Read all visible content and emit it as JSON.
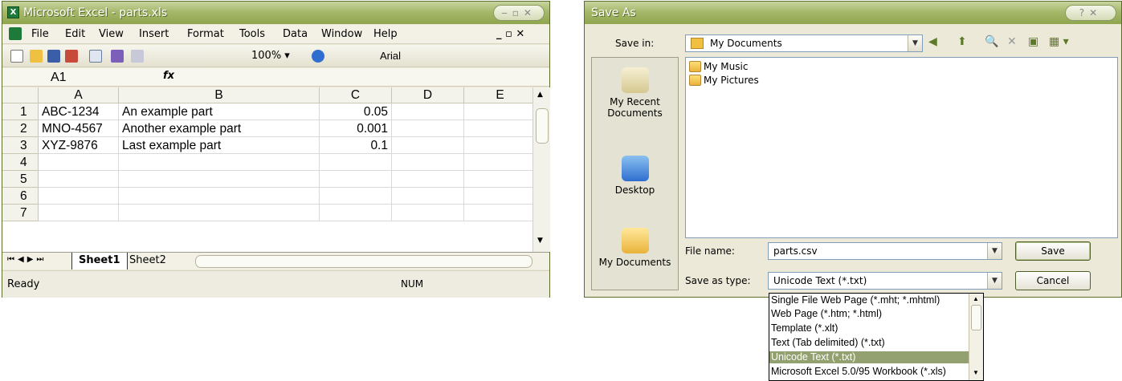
{
  "excel": {
    "title": "Microsoft Excel - parts.xls",
    "menu": [
      "File",
      "Edit",
      "View",
      "Insert",
      "Format",
      "Tools",
      "Data",
      "Window",
      "Help"
    ],
    "zoom": "100%",
    "font": "Arial",
    "name_box": "A1",
    "fx_label": "fx",
    "columns": [
      "A",
      "B",
      "C",
      "D",
      "E"
    ],
    "rows": [
      {
        "num": "1",
        "a": "ABC-1234",
        "b": "An example part",
        "c": "0.05"
      },
      {
        "num": "2",
        "a": "MNO-4567",
        "b": "Another example part",
        "c": "0.001"
      },
      {
        "num": "3",
        "a": "XYZ-9876",
        "b": "Last example part",
        "c": "0.1"
      },
      {
        "num": "4",
        "a": "",
        "b": "",
        "c": ""
      },
      {
        "num": "5",
        "a": "",
        "b": "",
        "c": ""
      },
      {
        "num": "6",
        "a": "",
        "b": "",
        "c": ""
      },
      {
        "num": "7",
        "a": "",
        "b": "",
        "c": ""
      }
    ],
    "sheets": [
      "Sheet1",
      "Sheet2"
    ],
    "status_left": "Ready",
    "status_right": "NUM"
  },
  "saveas": {
    "title": "Save As",
    "save_in_label": "Save in:",
    "save_in_value": "My Documents",
    "places": [
      "My Recent Documents",
      "Desktop",
      "My Documents"
    ],
    "files": [
      "My Music",
      "My Pictures"
    ],
    "file_name_label": "File name:",
    "file_name_value": "parts.csv",
    "save_type_label": "Save as type:",
    "save_type_value": "Unicode Text (*.txt)",
    "save_button": "Save",
    "cancel_button": "Cancel",
    "type_options": [
      "Single File Web Page (*.mht; *.mhtml)",
      "Web Page (*.htm; *.html)",
      "Template (*.xlt)",
      "Text (Tab delimited) (*.txt)",
      "Unicode Text (*.txt)",
      "Microsoft Excel 5.0/95 Workbook (*.xls)"
    ],
    "selected_option": "Unicode Text (*.txt)"
  }
}
